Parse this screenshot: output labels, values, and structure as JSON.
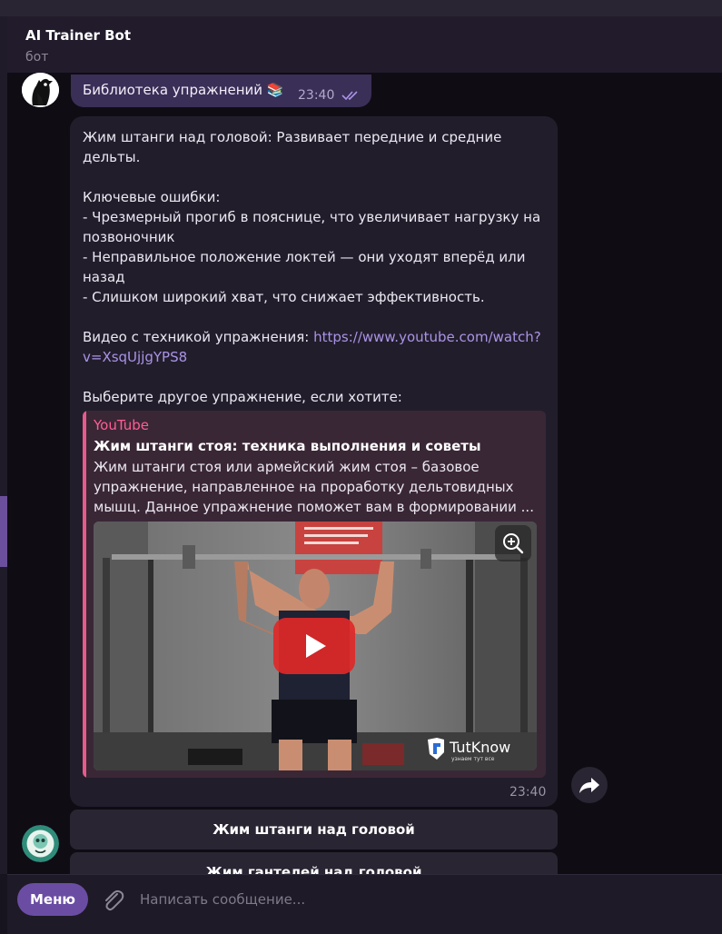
{
  "header": {
    "title": "AI Trainer Bot",
    "status": "бот"
  },
  "outgoing": {
    "text": "Библиотека упражнений 📚",
    "time": "23:40"
  },
  "message": {
    "text": "Жим штанги над головой: Развивает передние и средние\nдельты.\n\nКлючевые ошибки:\n- Чрезмерный прогиб в пояснице, что увеличивает нагрузку на\nпозвоночник\n- Неправильное положение локтей — они уходят вперёд или\nназад\n- Слишком широкий хват, что снижает эффективность.\n\n",
    "video_label": "Видео с техникой упражнения: ",
    "video_link": "https://www.youtube.com/watch?\nv=XsqUjjgYPS8",
    "tail": "\n\nВыберите другое упражнение, если хотите:",
    "time": "23:40",
    "preview": {
      "site": "YouTube",
      "title": "Жим штанги стоя: техника выполнения и советы",
      "description": "Жим штанги стоя или армейский жим стоя – базовое упражнение, направленное на проработку дельтовидных мышц. Данное  упражнение поможет вам в формировании ...",
      "watermark": "TutKnow",
      "watermark_sub": "узнаем тут все"
    }
  },
  "keyboard": [
    "Жим штанги над головой",
    "Жим гантелей над головой"
  ],
  "input": {
    "menu_label": "Меню",
    "placeholder": "Написать сообщение..."
  },
  "colors": {
    "accent": "#6a4da3",
    "link": "#a994e6",
    "youtube": "#ff5e93",
    "play": "#e02828"
  },
  "icons": [
    "double-check-icon",
    "zoom-in-icon",
    "play-icon",
    "forward-icon",
    "paperclip-icon",
    "bot-avatar-icon",
    "user-avatar-icon"
  ]
}
